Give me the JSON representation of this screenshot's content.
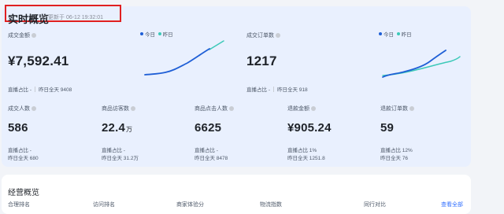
{
  "header": {
    "title": "实时概览",
    "updated": "更新于 06-12 19:32:01"
  },
  "legend": {
    "today": "今日",
    "yesterday": "昨日",
    "today_color": "#1f5fd6",
    "yesterday_color": "#3cc9b8"
  },
  "metrics": [
    {
      "label": "成交金额",
      "value": "¥7,592.41",
      "sub1_label": "直播占比",
      "sub1_value": "-",
      "sub2": "昨日全天 9408"
    },
    {
      "label": "成交订单数",
      "value": "1217",
      "sub1_label": "直播占比",
      "sub1_value": "-",
      "sub2": "昨日全天 918"
    },
    {
      "label": "成交人数",
      "value": "586",
      "sub1": "直播占比 -",
      "sub2": "昨日全天 680"
    },
    {
      "label": "商品访客数",
      "value": "22.4",
      "unit": "万",
      "sub1": "直播占比 -",
      "sub2": "昨日全天 31.2万"
    },
    {
      "label": "商品点击人数",
      "value": "6625",
      "sub1": "直播占比 -",
      "sub2": "昨日全天 8478"
    },
    {
      "label": "退款金额",
      "value": "¥905.24",
      "sub1": "直播占比 1%",
      "sub2": "昨日全天 1251.8"
    },
    {
      "label": "退款订单数",
      "value": "59",
      "sub1": "直播占比 12%",
      "sub2": "昨日全天 76"
    }
  ],
  "sparklines": {
    "gmv": {
      "today": [
        2,
        3,
        3.5,
        5,
        8,
        12,
        16
      ],
      "yesterday": [
        14,
        18
      ]
    },
    "orders": {
      "today": [
        2,
        3,
        4,
        6,
        9,
        13,
        17
      ],
      "yesterday": [
        1,
        2,
        3,
        4,
        6,
        9,
        12,
        15
      ]
    }
  },
  "section2": {
    "title": "经营概览",
    "columns": [
      "合理排名",
      "访问排名",
      "商家体验分",
      "物流指数",
      "同行对比"
    ],
    "view_all": "查看全部"
  }
}
